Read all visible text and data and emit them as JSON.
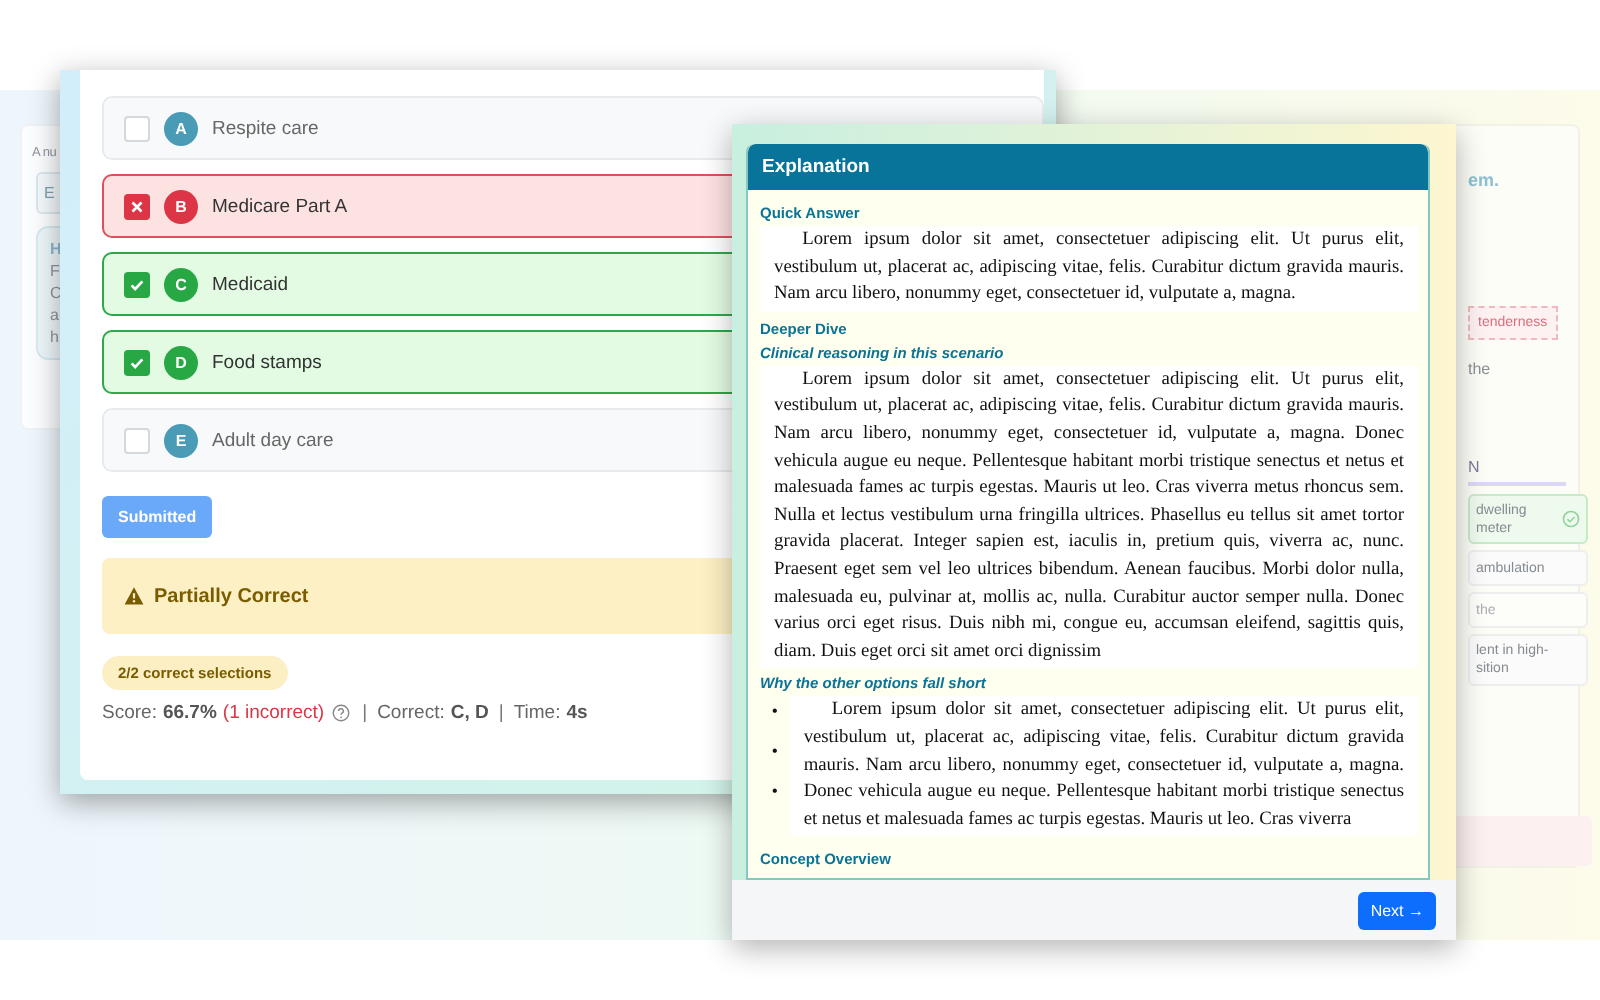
{
  "background": {
    "left_card": {
      "intro": "A nu",
      "tab": "E",
      "note_lines": [
        "H",
        "F",
        "C",
        "a",
        "h"
      ]
    },
    "right_card": {
      "heading_end": "em.",
      "tag": "tenderness",
      "text_end": "the",
      "section_title": "N",
      "options": [
        {
          "lines": [
            "dwelling",
            "meter"
          ],
          "correct": true,
          "disabled": false
        },
        {
          "lines": [
            "ambulation"
          ],
          "correct": false,
          "disabled": false
        },
        {
          "lines": [
            "the"
          ],
          "correct": false,
          "disabled": true
        },
        {
          "lines": [
            "lent in high-",
            "sition"
          ],
          "correct": false,
          "disabled": false
        }
      ]
    }
  },
  "question": {
    "options": [
      {
        "letter": "A",
        "label": "Respite care",
        "checked": false,
        "kind": "neutral"
      },
      {
        "letter": "B",
        "label": "Medicare Part A",
        "checked": true,
        "kind": "incorrect"
      },
      {
        "letter": "C",
        "label": "Medicaid",
        "checked": true,
        "kind": "correct"
      },
      {
        "letter": "D",
        "label": "Food stamps",
        "checked": true,
        "kind": "correct"
      },
      {
        "letter": "E",
        "label": "Adult day care",
        "checked": false,
        "kind": "neutral"
      }
    ],
    "submit_button": {
      "label": "Submitted",
      "disabled": true
    },
    "result": {
      "kind": "partial",
      "title": "Partially Correct"
    },
    "badge": "2/2 correct selections",
    "score": [
      {
        "kind": "label",
        "text": "Score:"
      },
      {
        "kind": "value",
        "text": "66.7%"
      },
      {
        "kind": "error",
        "text": "(1 incorrect)"
      },
      {
        "kind": "help"
      },
      {
        "kind": "separator",
        "text": "|"
      },
      {
        "kind": "label",
        "text": "Correct:"
      },
      {
        "kind": "value",
        "text": "C, D"
      },
      {
        "kind": "separator",
        "text": "|"
      },
      {
        "kind": "label",
        "text": "Time:"
      },
      {
        "kind": "value",
        "text": "4s"
      }
    ]
  },
  "explanation": {
    "title": "Explanation",
    "blocks": [
      {
        "kind": "heading",
        "text": "Quick Answer"
      },
      {
        "kind": "paragraph",
        "text": "Lorem ipsum dolor sit amet, consectetuer adipiscing elit. Ut purus elit, vestibulum ut, placerat ac, adipiscing vitae, felis. Curabitur dictum gravida mauris. Nam arcu libero, nonummy eget, consectetuer id, vulputate a, magna."
      },
      {
        "kind": "heading",
        "text": "Deeper Dive"
      },
      {
        "kind": "subheading",
        "text": "Clinical reasoning in this scenario"
      },
      {
        "kind": "paragraph",
        "text": "Lorem ipsum dolor sit amet, consectetuer adipiscing elit. Ut purus elit, vestibulum ut, placerat ac, adipiscing vitae, felis. Curabitur dictum gravida mauris. Nam arcu libero, nonummy eget, consectetuer id, vulputate a, magna. Donec vehicula augue eu neque. Pellentesque habitant morbi tristique senectus et netus et malesuada fames ac turpis egestas. Mauris ut leo. Cras viverra metus rhoncus sem. Nulla et lectus vestibulum urna fringilla ultrices. Phasellus eu tellus sit amet tortor gravida placerat. Integer sapien est, iaculis in, pretium quis, viverra ac, nunc. Praesent eget sem vel leo ultrices bibendum. Aenean faucibus. Morbi dolor nulla, malesuada eu, pulvinar at, mollis ac, nulla. Curabitur auctor semper nulla. Donec varius orci eget risus. Duis nibh mi, congue eu, accumsan eleifend, sagittis quis, diam. Duis eget orci sit amet orci dignissim"
      },
      {
        "kind": "subheading",
        "text": "Why the other options fall short"
      },
      {
        "kind": "bullet_list",
        "markers": [
          "•",
          "•",
          "•"
        ],
        "text": "Lorem ipsum dolor sit amet, consectetuer adipiscing elit. Ut purus elit, vestibulum ut, placerat ac, adipiscing vitae, felis. Curabitur dictum gravida mauris. Nam arcu libero, nonummy eget, consectetuer id, vulputate a, magna. Donec vehicula augue eu neque. Pellentesque habitant morbi tristique senectus et netus et malesuada fames ac turpis egestas. Mauris ut leo. Cras viverra"
      },
      {
        "kind": "heading",
        "text": "Concept Overview"
      }
    ],
    "next_button": "Next →"
  }
}
